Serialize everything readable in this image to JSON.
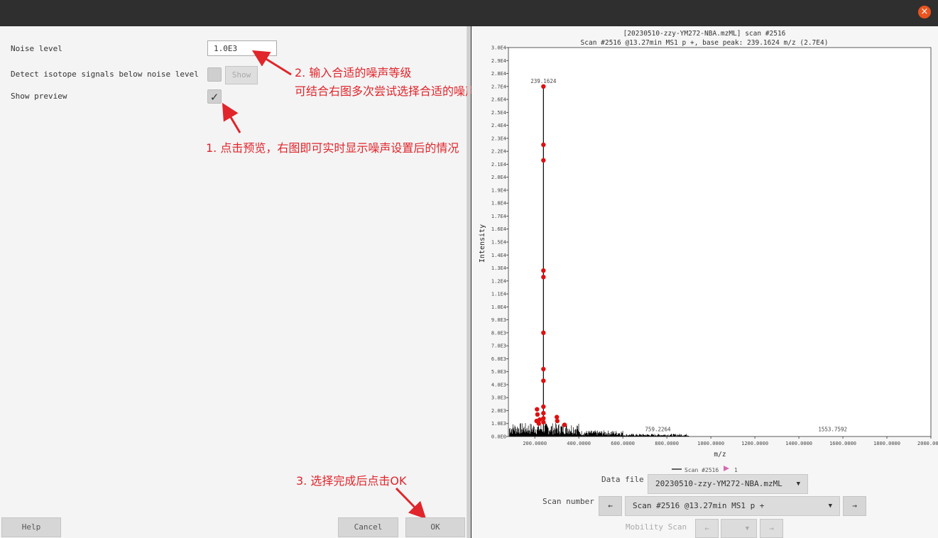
{
  "left": {
    "noise_level_label": "Noise level",
    "noise_level_value": "1.0E3",
    "detect_isotope_label": "Detect isotope signals below noise level",
    "show_button": "Show",
    "show_preview_label": "Show preview",
    "show_preview_check": "✓"
  },
  "annotations": {
    "a2_line1": "2. 输入合适的噪声等级",
    "a2_line2": "可结合右图多次尝试选择合适的噪声等级",
    "a1": "1. 点击预览，右图即可实时显示噪声设置后的情况",
    "a3": "3. 选择完成后点击OK",
    "color": "#e0252b"
  },
  "buttons": {
    "help": "Help",
    "cancel": "Cancel",
    "ok": "OK"
  },
  "window": {
    "close_icon": "×",
    "close_color": "#e9541f"
  },
  "right": {
    "data_file_label": "Data file",
    "data_file_value": "20230510-zzy-YM272-NBA.mzML",
    "scan_number_label": "Scan number",
    "scan_value": "Scan #2516 @13.27min MS1 p +",
    "prev_arrow": "←",
    "next_arrow": "→",
    "mobility_label": "Mobility Scan",
    "dropdown_arrow": "▼"
  },
  "chart_data": {
    "type": "line",
    "title": "[20230510-zzy-YM272-NBA.mzML] scan #2516",
    "subtitle": "Scan #2516 @13.27min MS1 p +, base peak: 239.1624 m/z (2.7E4)",
    "xlabel": "m/z",
    "ylabel": "Intensity",
    "xlim": [
      80,
      2000
    ],
    "ylim": [
      0,
      30000
    ],
    "x_ticks": [
      "200.0000",
      "400.0000",
      "600.0000",
      "800.0000",
      "1000.0000",
      "1200.0000",
      "1400.0000",
      "1600.0000",
      "1800.0000",
      "2000.0000"
    ],
    "x_tick_values": [
      200,
      400,
      600,
      800,
      1000,
      1200,
      1400,
      1600,
      1800,
      2000
    ],
    "y_ticks": [
      "0.0E0",
      "1.0E3",
      "2.0E3",
      "3.0E3",
      "4.0E3",
      "5.0E3",
      "6.0E3",
      "7.0E3",
      "8.0E3",
      "9.0E3",
      "1.0E4",
      "1.1E4",
      "1.2E4",
      "1.3E4",
      "1.4E4",
      "1.5E4",
      "1.6E4",
      "1.7E4",
      "1.8E4",
      "1.9E4",
      "2.0E4",
      "2.1E4",
      "2.2E4",
      "2.3E4",
      "2.4E4",
      "2.5E4",
      "2.6E4",
      "2.7E4",
      "2.8E4",
      "2.9E4",
      "3.0E4"
    ],
    "peak_labels": [
      {
        "label": "239.1624",
        "x": 239.1624,
        "y": 27000
      },
      {
        "label": "759.2264",
        "x": 759.2264,
        "y": 150
      },
      {
        "label": "1553.7592",
        "x": 1553.7592,
        "y": 150
      }
    ],
    "base_peak": {
      "x": 239.1624,
      "y": 27000
    },
    "detected_points": [
      {
        "x": 239.16,
        "y": 27000
      },
      {
        "x": 239.16,
        "y": 22500
      },
      {
        "x": 239.16,
        "y": 21300
      },
      {
        "x": 239.16,
        "y": 12800
      },
      {
        "x": 239.16,
        "y": 12300
      },
      {
        "x": 239.16,
        "y": 8000
      },
      {
        "x": 239.16,
        "y": 5200
      },
      {
        "x": 239.16,
        "y": 4300
      },
      {
        "x": 239.16,
        "y": 2300
      },
      {
        "x": 239.16,
        "y": 1800
      },
      {
        "x": 239.16,
        "y": 1400
      },
      {
        "x": 239.16,
        "y": 1100
      },
      {
        "x": 210,
        "y": 2100
      },
      {
        "x": 212,
        "y": 1700
      },
      {
        "x": 208,
        "y": 1200
      },
      {
        "x": 222,
        "y": 1300
      },
      {
        "x": 218,
        "y": 1000
      },
      {
        "x": 300,
        "y": 1500
      },
      {
        "x": 302,
        "y": 1200
      },
      {
        "x": 335,
        "y": 900
      }
    ],
    "legend": [
      {
        "name": "Scan #2516",
        "color": "#000000"
      },
      {
        "name": "1",
        "color": "#d36bb0"
      }
    ],
    "legend_position": "bottom",
    "series_color": "#000000",
    "point_color": "#dd1111",
    "grid": false
  }
}
